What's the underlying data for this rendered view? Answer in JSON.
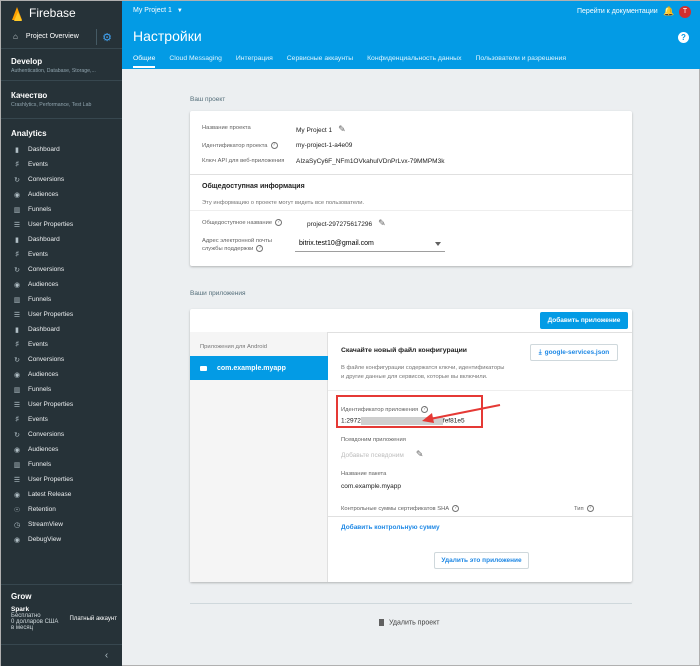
{
  "brand": {
    "name": "Firebase",
    "accent": "#039be5",
    "sidebar_bg": "#263238"
  },
  "sidebar": {
    "overview": "Project Overview",
    "develop": {
      "title": "Develop",
      "subtitle": "Authentication, Database, Storage,..."
    },
    "quality": {
      "title": "Качество",
      "subtitle": "Crashlytics, Performance, Test Lab"
    },
    "analytics_title": "Analytics",
    "items": [
      {
        "label": "Dashboard",
        "icon": "dashboard-icon"
      },
      {
        "label": "Events",
        "icon": "events-icon"
      },
      {
        "label": "Conversions",
        "icon": "conversions-icon"
      },
      {
        "label": "Audiences",
        "icon": "audiences-icon"
      },
      {
        "label": "Funnels",
        "icon": "funnels-icon"
      },
      {
        "label": "User Properties",
        "icon": "user-properties-icon"
      },
      {
        "label": "Dashboard",
        "icon": "dashboard-icon"
      },
      {
        "label": "Events",
        "icon": "events-icon"
      },
      {
        "label": "Conversions",
        "icon": "conversions-icon"
      },
      {
        "label": "Audiences",
        "icon": "audiences-icon"
      },
      {
        "label": "Funnels",
        "icon": "funnels-icon"
      },
      {
        "label": "User Properties",
        "icon": "user-properties-icon"
      },
      {
        "label": "Dashboard",
        "icon": "dashboard-icon"
      },
      {
        "label": "Events",
        "icon": "events-icon"
      },
      {
        "label": "Conversions",
        "icon": "conversions-icon"
      },
      {
        "label": "Audiences",
        "icon": "audiences-icon"
      },
      {
        "label": "Funnels",
        "icon": "funnels-icon"
      },
      {
        "label": "User Properties",
        "icon": "user-properties-icon"
      },
      {
        "label": "Events",
        "icon": "events-icon"
      },
      {
        "label": "Conversions",
        "icon": "conversions-icon"
      },
      {
        "label": "Audiences",
        "icon": "audiences-icon"
      },
      {
        "label": "Funnels",
        "icon": "funnels-icon"
      },
      {
        "label": "User Properties",
        "icon": "user-properties-icon"
      },
      {
        "label": "Latest Release",
        "icon": "latest-release-icon"
      },
      {
        "label": "Retention",
        "icon": "retention-icon"
      },
      {
        "label": "StreamView",
        "icon": "streamview-icon"
      },
      {
        "label": "DebugView",
        "icon": "debugview-icon"
      }
    ],
    "grow": "Grow",
    "plan": {
      "name": "Spark",
      "desc1": "Бесплатно",
      "desc2": "0 долларов США",
      "desc3": "в месяц",
      "paid": "Платный аккаунт"
    }
  },
  "header": {
    "project": "My Project 1",
    "docs": "Перейти к документации",
    "avatar": "T",
    "title": "Настройки",
    "help": "?",
    "tabs": [
      "Общие",
      "Cloud Messaging",
      "Интеграция",
      "Сервисные аккаунты",
      "Конфиденциальность данных",
      "Пользователи и разрешения"
    ]
  },
  "project": {
    "section": "Ваш проект",
    "name_label": "Название проекта",
    "name_value": "My Project 1",
    "id_label": "Идентификатор проекта",
    "id_value": "my-project-1-a4e09",
    "apikey_label": "Ключ API для веб-приложения",
    "apikey_value": "AIzaSyCy6F_NFm1OVkahulVDnPrLvx-79MMPM3k",
    "public_title": "Общедоступная информация",
    "public_desc": "Эту информацию о проекте могут видеть все пользователи.",
    "public_name_label": "Общедоступное название",
    "public_name_value": "project-297275617296",
    "email_label1": "Адрес электронной почты",
    "email_label2": "службы поддержки",
    "email_value": "bitrix.test10@gmail.com"
  },
  "apps": {
    "section": "Ваши приложения",
    "add_button": "Добавить приложение",
    "android_header": "Приложения для Android",
    "app_name": "com.example.myapp",
    "config_title": "Скачайте новый файл конфигурации",
    "config_desc1": "В файле конфигурации содержатся ключи, идентификаторы",
    "config_desc2": "и другие данные для сервисов, которые вы включили.",
    "download_button": "google-services.json",
    "appid_label": "Идентификатор приложения",
    "appid_prefix": "1:2972",
    "appid_suffix": "fef81e5",
    "alias_label": "Псевдоним приложения",
    "alias_placeholder": "Добавьте псевдоним",
    "package_label": "Название пакета",
    "package_value": "com.example.myapp",
    "sha_label": "Контрольные суммы сертификатов SHA",
    "type_label": "Тип",
    "add_checksum": "Добавить контрольную сумму",
    "delete_app": "Удалить это приложение"
  },
  "delete_project": "Удалить проект"
}
